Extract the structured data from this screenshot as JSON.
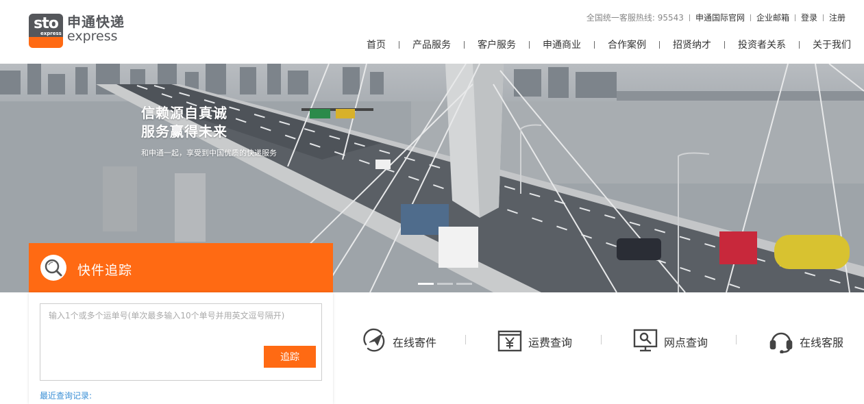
{
  "logo": {
    "badge": "sto",
    "badge_sub": "express",
    "cn": "申通快递",
    "en": "express"
  },
  "toplinks": {
    "hotline": "全国统一客服热线: 95543",
    "items": [
      "申通国际官网",
      "企业邮箱",
      "登录",
      "注册"
    ]
  },
  "nav": [
    "首页",
    "产品服务",
    "客户服务",
    "申通商业",
    "合作案例",
    "招贤纳才",
    "投资者关系",
    "关于我们"
  ],
  "hero": {
    "title_line1": "信赖源自真诚",
    "title_line2": "服务赢得未来",
    "subtitle": "和申通一起，享受到中国优质的快递服务",
    "slides": 3,
    "active_slide": 1
  },
  "tracking": {
    "title": "快件追踪",
    "placeholder": "输入1个或多个运单号(单次最多输入10个单号并用英文逗号隔开)",
    "button": "追踪",
    "recent_label": "最近查询记录:"
  },
  "services": [
    {
      "label": "在线寄件",
      "icon": "plane-send-icon"
    },
    {
      "label": "运费查询",
      "icon": "yen-receipt-icon"
    },
    {
      "label": "网点查询",
      "icon": "location-monitor-icon"
    },
    {
      "label": "在线客服",
      "icon": "headset-icon"
    }
  ],
  "colors": {
    "accent": "#ff6a13",
    "logo_gray": "#55575b",
    "link_blue": "#3a8fd6"
  }
}
